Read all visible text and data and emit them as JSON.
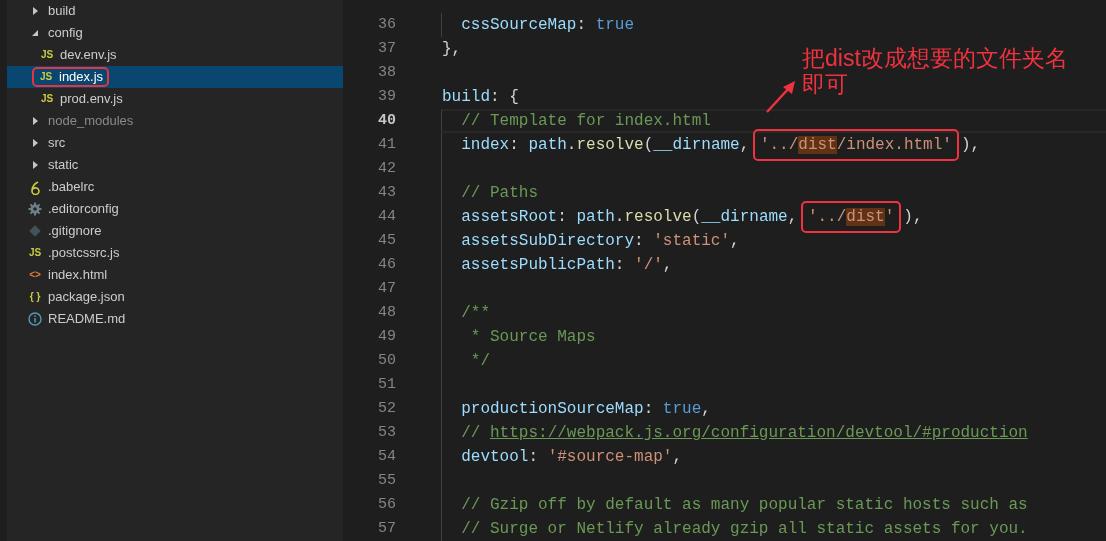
{
  "explorer": {
    "items": [
      {
        "kind": "folder",
        "name": "build",
        "expanded": false,
        "selected": false,
        "dimmed": false,
        "annotated": false
      },
      {
        "kind": "folder",
        "name": "config",
        "expanded": true,
        "selected": false,
        "dimmed": false,
        "annotated": false,
        "children": [
          {
            "kind": "file",
            "name": "dev.env.js",
            "icon": {
              "kind": "text",
              "text": "JS",
              "color": "#cbcb41"
            },
            "selected": false,
            "dimmed": false,
            "annotated": false
          },
          {
            "kind": "file",
            "name": "index.js",
            "icon": {
              "kind": "text",
              "text": "JS",
              "color": "#cbcb41"
            },
            "selected": true,
            "dimmed": false,
            "annotated": true
          },
          {
            "kind": "file",
            "name": "prod.env.js",
            "icon": {
              "kind": "text",
              "text": "JS",
              "color": "#cbcb41"
            },
            "selected": false,
            "dimmed": false,
            "annotated": false
          }
        ]
      },
      {
        "kind": "folder",
        "name": "node_modules",
        "expanded": false,
        "selected": false,
        "dimmed": true,
        "annotated": false
      },
      {
        "kind": "folder",
        "name": "src",
        "expanded": false,
        "selected": false,
        "dimmed": false,
        "annotated": false
      },
      {
        "kind": "folder",
        "name": "static",
        "expanded": false,
        "selected": false,
        "dimmed": false,
        "annotated": false
      },
      {
        "kind": "file",
        "name": ".babelrc",
        "icon": {
          "kind": "babel",
          "color": "#cbcb41"
        },
        "selected": false,
        "dimmed": false,
        "annotated": false
      },
      {
        "kind": "file",
        "name": ".editorconfig",
        "icon": {
          "kind": "gear",
          "color": "#6d8086"
        },
        "selected": false,
        "dimmed": false,
        "annotated": false
      },
      {
        "kind": "file",
        "name": ".gitignore",
        "icon": {
          "kind": "git",
          "color": "#41535b"
        },
        "selected": false,
        "dimmed": false,
        "annotated": false
      },
      {
        "kind": "file",
        "name": ".postcssrc.js",
        "icon": {
          "kind": "text",
          "text": "JS",
          "color": "#cbcb41"
        },
        "selected": false,
        "dimmed": false,
        "annotated": false
      },
      {
        "kind": "file",
        "name": "index.html",
        "icon": {
          "kind": "text",
          "text": "<>",
          "color": "#e37933"
        },
        "selected": false,
        "dimmed": false,
        "annotated": false
      },
      {
        "kind": "file",
        "name": "package.json",
        "icon": {
          "kind": "text",
          "text": "{ }",
          "color": "#cbcb41"
        },
        "selected": false,
        "dimmed": false,
        "annotated": false
      },
      {
        "kind": "file",
        "name": "README.md",
        "icon": {
          "kind": "info",
          "color": "#519aba"
        },
        "selected": false,
        "dimmed": false,
        "annotated": false
      }
    ]
  },
  "editor": {
    "lines": [
      {
        "number": "36",
        "current": false,
        "tokens": [
          {
            "kind": "property",
            "text": "  cssSourceMap"
          },
          {
            "kind": "punct",
            "text": ": "
          },
          {
            "kind": "keyword",
            "text": "true"
          }
        ]
      },
      {
        "number": "37",
        "current": false,
        "tokens": [
          {
            "kind": "punct",
            "text": "},"
          }
        ]
      },
      {
        "number": "38",
        "current": false
      },
      {
        "number": "39",
        "current": false,
        "tokens": [
          {
            "kind": "property",
            "text": "build"
          },
          {
            "kind": "punct",
            "text": ": {"
          }
        ]
      },
      {
        "number": "40",
        "current": true,
        "tokens": [
          {
            "kind": "comment",
            "text": "  // Template for index.html"
          }
        ]
      },
      {
        "number": "41",
        "current": false,
        "tokens": [
          {
            "kind": "property",
            "text": "  index"
          },
          {
            "kind": "punct",
            "text": ": "
          },
          {
            "kind": "property",
            "text": "path"
          },
          {
            "kind": "punct",
            "text": "."
          },
          {
            "kind": "function",
            "text": "resolve"
          },
          {
            "kind": "punct",
            "text": "("
          },
          {
            "kind": "property",
            "text": "__dirname"
          },
          {
            "kind": "punct",
            "text": ", "
          },
          {
            "kind": "boxed",
            "parts": [
              {
                "kind": "string",
                "text": "'../"
              },
              {
                "kind": "match",
                "text": "dist"
              },
              {
                "kind": "string",
                "text": "/index.html'"
              }
            ]
          },
          {
            "kind": "punct",
            "text": "),"
          }
        ]
      },
      {
        "number": "42",
        "current": false
      },
      {
        "number": "43",
        "current": false,
        "tokens": [
          {
            "kind": "comment",
            "text": "  // Paths"
          }
        ]
      },
      {
        "number": "44",
        "current": false,
        "tokens": [
          {
            "kind": "property",
            "text": "  assetsRoot"
          },
          {
            "kind": "punct",
            "text": ": "
          },
          {
            "kind": "property",
            "text": "path"
          },
          {
            "kind": "punct",
            "text": "."
          },
          {
            "kind": "function",
            "text": "resolve"
          },
          {
            "kind": "punct",
            "text": "("
          },
          {
            "kind": "property",
            "text": "__dirname"
          },
          {
            "kind": "punct",
            "text": ", "
          },
          {
            "kind": "boxed",
            "parts": [
              {
                "kind": "string",
                "text": "'../"
              },
              {
                "kind": "match",
                "text": "dist"
              },
              {
                "kind": "string",
                "text": "'"
              }
            ]
          },
          {
            "kind": "punct",
            "text": "),"
          }
        ]
      },
      {
        "number": "45",
        "current": false,
        "tokens": [
          {
            "kind": "property",
            "text": "  assetsSubDirectory"
          },
          {
            "kind": "punct",
            "text": ": "
          },
          {
            "kind": "string",
            "text": "'static'"
          },
          {
            "kind": "punct",
            "text": ","
          }
        ]
      },
      {
        "number": "46",
        "current": false,
        "tokens": [
          {
            "kind": "property",
            "text": "  assetsPublicPath"
          },
          {
            "kind": "punct",
            "text": ": "
          },
          {
            "kind": "string",
            "text": "'/'"
          },
          {
            "kind": "punct",
            "text": ","
          }
        ]
      },
      {
        "number": "47",
        "current": false
      },
      {
        "number": "48",
        "current": false,
        "tokens": [
          {
            "kind": "comment",
            "text": "  /**"
          }
        ]
      },
      {
        "number": "49",
        "current": false,
        "tokens": [
          {
            "kind": "comment",
            "text": "   * Source Maps"
          }
        ]
      },
      {
        "number": "50",
        "current": false,
        "tokens": [
          {
            "kind": "comment",
            "text": "   */"
          }
        ]
      },
      {
        "number": "51",
        "current": false
      },
      {
        "number": "52",
        "current": false,
        "tokens": [
          {
            "kind": "property",
            "text": "  productionSourceMap"
          },
          {
            "kind": "punct",
            "text": ": "
          },
          {
            "kind": "keyword",
            "text": "true"
          },
          {
            "kind": "punct",
            "text": ","
          }
        ]
      },
      {
        "number": "53",
        "current": false,
        "tokens": [
          {
            "kind": "comment",
            "text": "  // "
          },
          {
            "kind": "link",
            "text": "https://webpack.js.org/configuration/devtool/#production"
          }
        ]
      },
      {
        "number": "54",
        "current": false,
        "tokens": [
          {
            "kind": "property",
            "text": "  devtool"
          },
          {
            "kind": "punct",
            "text": ": "
          },
          {
            "kind": "string",
            "text": "'#source-map'"
          },
          {
            "kind": "punct",
            "text": ","
          }
        ]
      },
      {
        "number": "55",
        "current": false
      },
      {
        "number": "56",
        "current": false,
        "tokens": [
          {
            "kind": "comment",
            "text": "  // Gzip off by default as many popular static hosts such as"
          }
        ]
      },
      {
        "number": "57",
        "current": false,
        "tokens": [
          {
            "kind": "comment",
            "text": "  // Surge or Netlify already gzip all static assets for you."
          }
        ]
      }
    ]
  },
  "annotation": {
    "note": "把dist改成想要的文件夹名即可"
  }
}
